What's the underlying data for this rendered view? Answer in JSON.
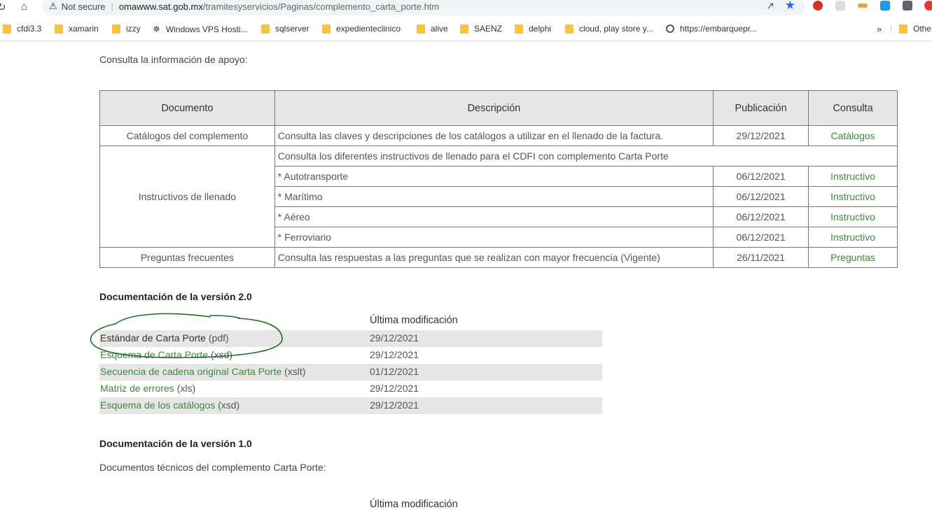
{
  "browser": {
    "security_label": "Not secure",
    "url_host": "omawww.sat.gob.mx",
    "url_path": "/tramitesyservicios/Paginas/complemento_carta_porte.htm",
    "bookmarks": [
      "cfdi3.3",
      "xamarin",
      "izzy",
      "Windows VPS Hosti...",
      "sqlserver",
      "expedienteclinico",
      "alive",
      "SAENZ",
      "delphi",
      "cloud, play store y...",
      "https://embarquepr..."
    ],
    "more_bookmarks": "»",
    "other_bookmarks": "Othe"
  },
  "support": {
    "intro": "Consulta la información de apoyo:",
    "headers": [
      "Documento",
      "Descripción",
      "Publicación",
      "Consulta"
    ],
    "catalogs_row": {
      "doc": "Catálogos del complemento",
      "desc": "Consulta las claves y descripciones de los catálogos a utilizar en el llenado de la factura.",
      "date": "29/12/2021",
      "link": "Catálogos"
    },
    "instructivos": {
      "doc": "Instructivos de llenado",
      "desc": "Consulta los diferentes instructivos de llenado para el CDFI con complemento Carta Porte",
      "items": [
        {
          "name": "* Autotransporte",
          "date": "06/12/2021",
          "link": "Instructivo"
        },
        {
          "name": "* Marítimo",
          "date": "06/12/2021",
          "link": "Instructivo"
        },
        {
          "name": "* Aéreo",
          "date": "06/12/2021",
          "link": "Instructivo"
        },
        {
          "name": "* Ferroviario",
          "date": "06/12/2021",
          "link": "Instructivo"
        }
      ]
    },
    "faq_row": {
      "doc": "Preguntas frecuentes",
      "desc": "Consulta las respuestas a las preguntas que se realizan con mayor frecuencia (Vigente)",
      "date": "26/11/2021",
      "link": "Preguntas"
    }
  },
  "v20": {
    "heading": "Documentación de la versión 2.0",
    "col_header": "Última modificación",
    "docs": [
      {
        "link": "Estándar de Carta Porte",
        "ext": " (pdf)",
        "date": "29/12/2021"
      },
      {
        "link": "Esquema de Carta Porte",
        "ext": " (xsd)",
        "date": "29/12/2021"
      },
      {
        "link": "Secuencia de cadena original Carta Porte",
        "ext": " (xslt)",
        "date": "01/12/2021"
      },
      {
        "link": "Matriz de errores",
        "ext": " (xls)",
        "date": "29/12/2021"
      },
      {
        "link": "Esquema de los catálogos",
        "ext": " (xsd)",
        "date": "29/12/2021"
      }
    ]
  },
  "v10": {
    "heading": "Documentación de la versión 1.0",
    "intro": "Documentos técnicos del complemento Carta Porte:",
    "col_header": "Última modificación"
  }
}
